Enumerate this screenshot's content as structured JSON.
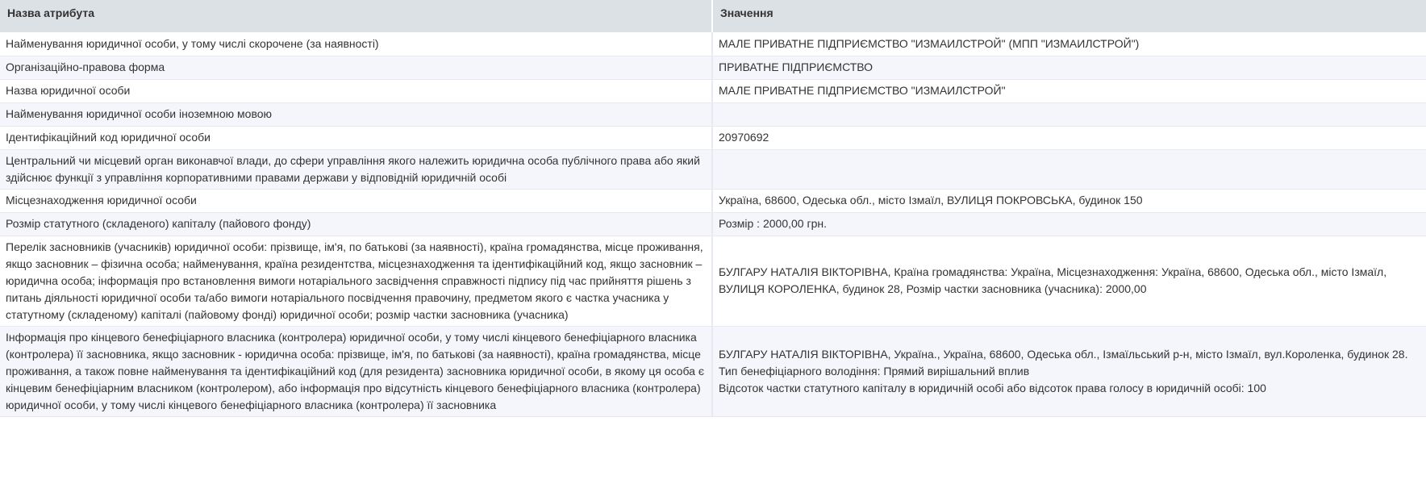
{
  "header": {
    "attribute_col": "Назва атрибута",
    "value_col": "Значення"
  },
  "rows": [
    {
      "attribute": "Найменування юридичної особи, у тому числі скорочене (за наявності)",
      "value": "МАЛЕ ПРИВАТНЕ ПІДПРИЄМСТВО \"ИЗМАИЛСТРОЙ\" (МПП \"ИЗМАИЛСТРОЙ\")"
    },
    {
      "attribute": "Організаційно-правова форма",
      "value": "ПРИВАТНЕ ПІДПРИЄМСТВО"
    },
    {
      "attribute": "Назва юридичної особи",
      "value": "МАЛЕ ПРИВАТНЕ ПІДПРИЄМСТВО \"ИЗМАИЛСТРОЙ\""
    },
    {
      "attribute": "Найменування юридичної особи іноземною мовою",
      "value": ""
    },
    {
      "attribute": "Ідентифікаційний код юридичної особи",
      "value": "20970692"
    },
    {
      "attribute": "Центральний чи місцевий орган виконавчої влади, до сфери управління якого належить юридична особа публічного права або який здійснює функції з управління корпоративними правами держави у відповідній юридичній особі",
      "value": ""
    },
    {
      "attribute": "Місцезнаходження юридичної особи",
      "value": "Україна, 68600, Одеська обл., місто Ізмаїл, ВУЛИЦЯ ПОКРОВСЬКА, будинок 150"
    },
    {
      "attribute": "Розмір статутного (складеного) капіталу (пайового фонду)",
      "value": "Розмір : 2000,00 грн."
    },
    {
      "attribute": "Перелік засновників (учасників) юридичної особи: прізвище, ім'я, по батькові (за наявності), країна громадянства, місце проживання, якщо засновник – фізична особа; найменування, країна резидентства, місцезнаходження та ідентифікаційний код, якщо засновник – юридична особа; інформація про встановлення вимоги нотаріального засвідчення справжності підпису під час прийняття рішень з питань діяльності юридичної особи та/або вимоги нотаріального посвідчення правочину, предметом якого є частка учасника у статутному (складеному) капіталі (пайовому фонді) юридичної особи; розмір частки засновника (учасника)",
      "value": "БУЛГАРУ НАТАЛІЯ ВІКТОРІВНА, Країна громадянства: Україна, Місцезнаходження: Україна, 68600, Одеська обл., місто Ізмаїл, ВУЛИЦЯ КОРОЛЕНКА, будинок 28, Розмір частки засновника (учасника): 2000,00"
    },
    {
      "attribute": "Інформація про кінцевого бенефіціарного власника (контролера) юридичної особи, у тому числі кінцевого бенефіціарного власника (контролера) її засновника, якщо засновник - юридична особа: прізвище, ім'я, по батькові (за наявності), країна громадянства, місце проживання, а також повне найменування та ідентифікаційний код (для резидента) засновника юридичної особи, в якому ця особа є кінцевим бенефіціарним власником (контролером), або інформація про відсутність кінцевого бенефіціарного власника (контролера) юридичної особи, у тому числі кінцевого бенефіціарного власника (контролера) її засновника",
      "value": "БУЛГАРУ НАТАЛІЯ ВІКТОРІВНА, Україна., Україна, 68600, Одеська обл., Ізмаїльський р-н, місто Ізмаїл, вул.Короленка, будинок 28.",
      "value_2": "Тип бенефіціарного володіння: Прямий вирішальний вплив",
      "value_3": "Відсоток частки статутного капіталу в юридичній особі або відсоток права голосу в юридичній особі: 100"
    }
  ]
}
